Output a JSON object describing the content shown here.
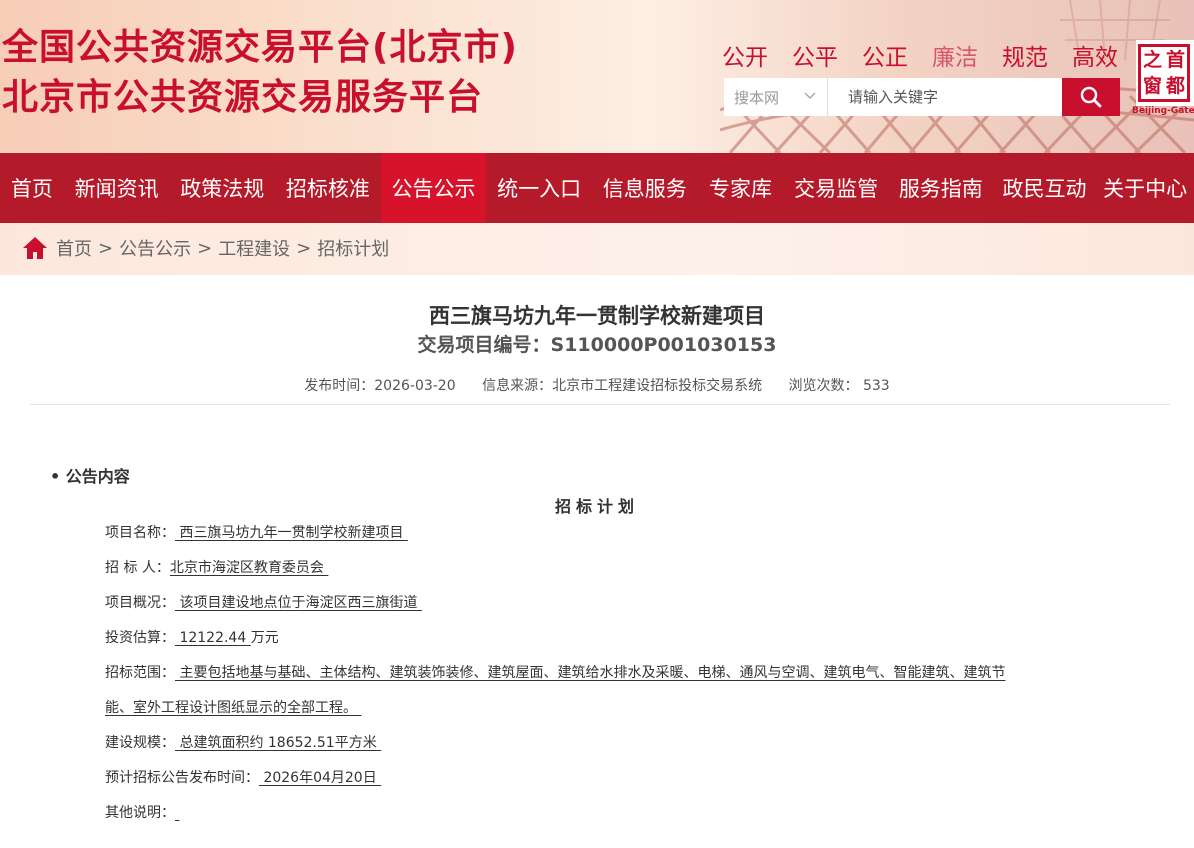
{
  "header": {
    "title_line1": "全国公共资源交易平台(北京市)",
    "title_line2": "北京市公共资源交易服务平台",
    "slogans": [
      "公开",
      "公平",
      "公正",
      "廉洁",
      "规范",
      "高效"
    ],
    "search": {
      "scope": "搜本网",
      "placeholder": "请输入关键字"
    },
    "logo": {
      "chars": [
        "之",
        "首",
        "窗",
        "都"
      ],
      "en": "Beijing-Gate"
    }
  },
  "nav": {
    "items": [
      "首页",
      "新闻资讯",
      "政策法规",
      "招标核准",
      "公告公示",
      "统一入口",
      "信息服务",
      "专家库",
      "交易监管",
      "服务指南",
      "政民互动",
      "关于中心"
    ],
    "active_index": 4
  },
  "breadcrumb": [
    "首页",
    "公告公示",
    "工程建设",
    "招标计划"
  ],
  "article": {
    "title": "西三旗马坊九年一贯制学校新建项目",
    "code": "交易项目编号：S110000P001030153",
    "publish_time": "发布时间：2026-03-20",
    "source": "信息来源：北京市工程建设招标投标交易系统",
    "views": "浏览次数：  533",
    "section_label": "• 公告内容",
    "plan_title": "招标计划",
    "fields": {
      "project_name_label": "项目名称：",
      "project_name": " 西三旗马坊九年一贯制学校新建项目 ",
      "tenderer_label": "招 标 人：",
      "tenderer": "北京市海淀区教育委员会 ",
      "overview_label": "项目概况：",
      "overview": " 该项目建设地点位于海淀区西三旗街道 ",
      "investment_label": "投资估算：",
      "investment": " 12122.44 ",
      "investment_unit": "万元",
      "scope_label": "招标范围：",
      "scope_line1": " 主要包括地基与基础、主体结构、建筑装饰装修、建筑屋面、建筑给水排水及采暖、电梯、通风与空调、建筑电气、智能建筑、建筑节",
      "scope_line2": "能、室外工程设计图纸显示的全部工程。 ",
      "scale_label": "建设规模：",
      "scale": " 总建筑面积约 18652.51平方米 ",
      "expected_label": "预计招标公告发布时间：",
      "expected": " 2026年04月20日 ",
      "other_label": "其他说明：",
      "other": " "
    }
  },
  "colors": {
    "brand_red": "#c8102e",
    "nav_bg": "#b51a2b",
    "nav_active": "#d6132a"
  }
}
